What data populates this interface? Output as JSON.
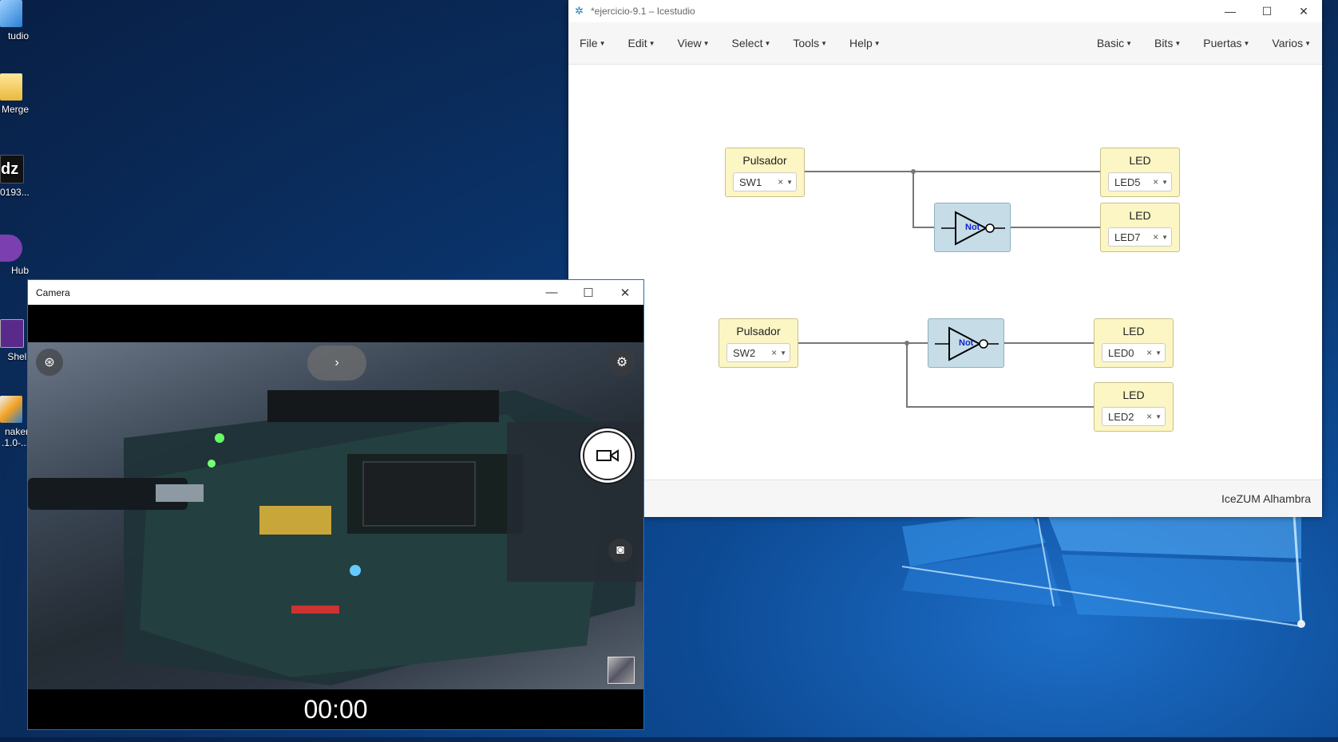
{
  "desktop": {
    "icons": [
      {
        "label": "tudio",
        "icon": "studio-icon"
      },
      {
        "label": "Merge",
        "icon": "folder-icon"
      },
      {
        "label": "0193...",
        "icon": "dz-icon"
      },
      {
        "label": "Hub",
        "icon": "github-icon"
      },
      {
        "label": "Shell",
        "icon": "shell-icon"
      },
      {
        "label": "naker",
        "label2": ".1.0-...",
        "icon": "installer-icon"
      }
    ]
  },
  "icestudio": {
    "title": "*ejercicio-9.1 – Icestudio",
    "menu_left": [
      "File",
      "Edit",
      "View",
      "Select",
      "Tools",
      "Help"
    ],
    "menu_right": [
      "Basic",
      "Bits",
      "Puertas",
      "Varios"
    ],
    "board": "IceZUM Alhambra",
    "blocks": {
      "pulsador1": {
        "title": "Pulsador",
        "value": "SW1"
      },
      "led5": {
        "title": "LED",
        "value": "LED5"
      },
      "led7": {
        "title": "LED",
        "value": "LED7"
      },
      "pulsador2": {
        "title": "Pulsador",
        "value": "SW2"
      },
      "led0": {
        "title": "LED",
        "value": "LED0"
      },
      "led2": {
        "title": "LED",
        "value": "LED2"
      }
    },
    "not_label": "Not"
  },
  "camera": {
    "title": "Camera",
    "timer": "00:00"
  }
}
